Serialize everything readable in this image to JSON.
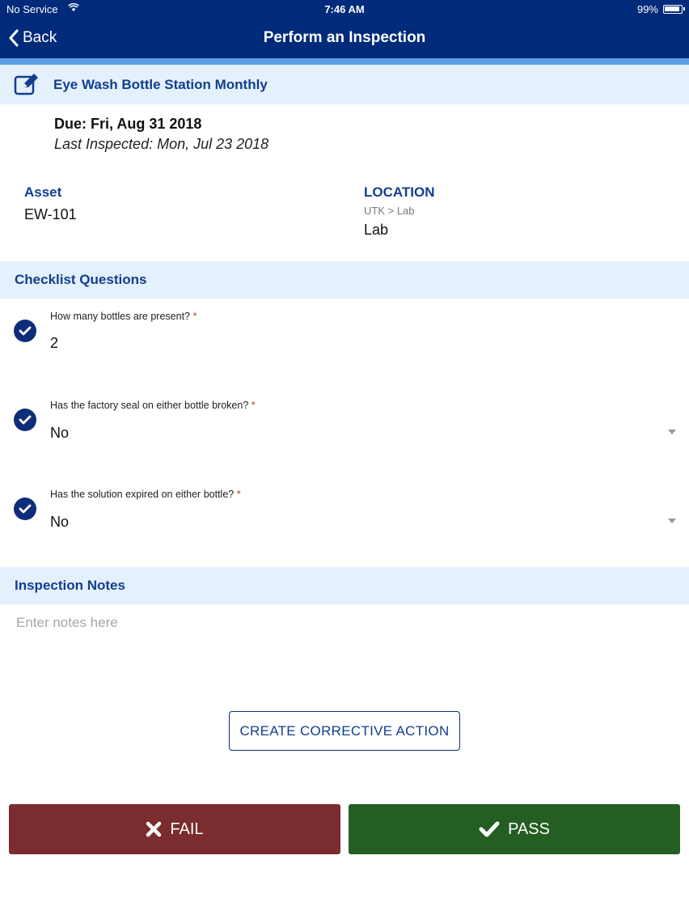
{
  "status_bar": {
    "carrier": "No Service",
    "time": "7:46 AM",
    "battery": "99%"
  },
  "nav": {
    "back_label": "Back",
    "title": "Perform an Inspection"
  },
  "inspection": {
    "title": "Eye Wash Bottle Station Monthly",
    "due": "Due: Fri, Aug 31 2018",
    "last_inspected": "Last Inspected: Mon, Jul 23 2018"
  },
  "asset": {
    "label": "Asset",
    "value": "EW-101"
  },
  "location": {
    "label": "LOCATION",
    "path": "UTK > Lab",
    "value": "Lab"
  },
  "checklist": {
    "header": "Checklist Questions",
    "questions": [
      {
        "text": "How many bottles are present?",
        "required": "*",
        "answer": "2"
      },
      {
        "text": "Has the factory seal on either bottle broken?",
        "required": "*",
        "answer": "No"
      },
      {
        "text": "Has the solution expired on either bottle?",
        "required": "*",
        "answer": "No"
      }
    ]
  },
  "notes": {
    "header": "Inspection Notes",
    "placeholder": "Enter notes here"
  },
  "actions": {
    "corrective_label": "CREATE CORRECTIVE ACTION",
    "fail_label": "FAIL",
    "pass_label": "PASS"
  },
  "colors": {
    "nav_bg": "#002a7a",
    "accent": "#5a9ee8",
    "section_bg": "#e4f0fb",
    "heading_text": "#123e8f",
    "fail": "#7b2c2e",
    "pass": "#255e23"
  }
}
